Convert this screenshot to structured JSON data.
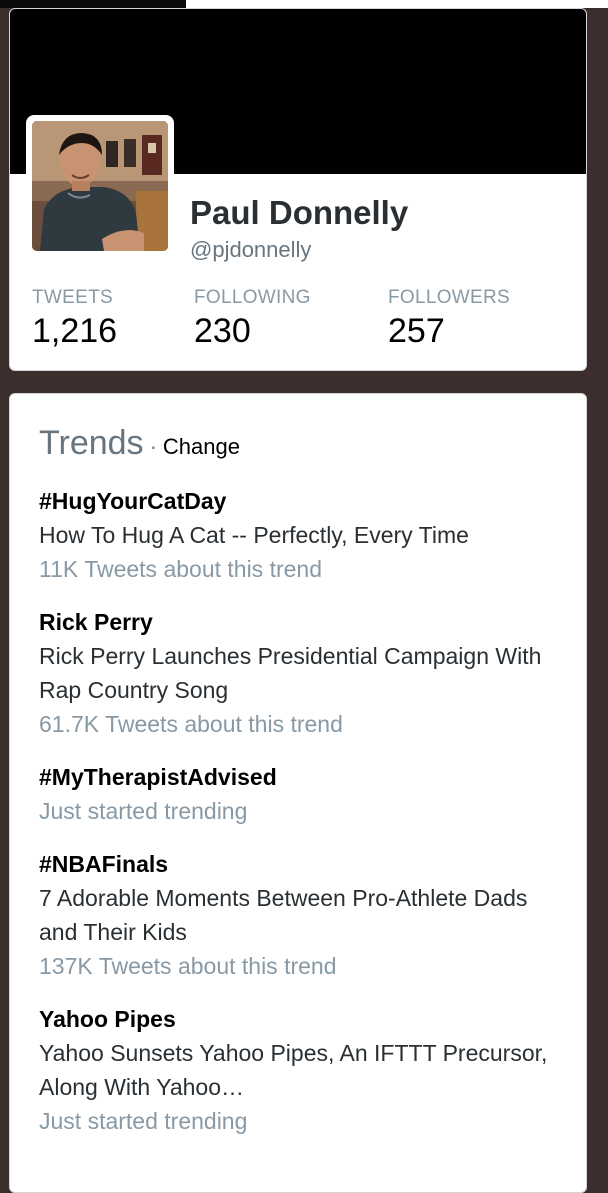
{
  "profile": {
    "name": "Paul Donnelly",
    "handle": "@pjdonnelly",
    "stats": [
      {
        "label": "TWEETS",
        "value": "1,216"
      },
      {
        "label": "FOLLOWING",
        "value": "230"
      },
      {
        "label": "FOLLOWERS",
        "value": "257"
      }
    ]
  },
  "trends": {
    "title": "Trends",
    "separator": "·",
    "change_label": "Change",
    "items": [
      {
        "name": "#HugYourCatDay",
        "description": "How To Hug A Cat -- Perfectly, Every Time",
        "meta": "11K Tweets about this trend"
      },
      {
        "name": "Rick Perry",
        "description": "Rick Perry Launches Presidential Campaign With Rap Country Song",
        "meta": "61.7K Tweets about this trend"
      },
      {
        "name": "#MyTherapistAdvised",
        "description": "",
        "meta": "Just started trending"
      },
      {
        "name": "#NBAFinals",
        "description": "7 Adorable Moments Between Pro-Athlete Dads and Their Kids",
        "meta": "137K Tweets about this trend"
      },
      {
        "name": "Yahoo Pipes",
        "description": "Yahoo Sunsets Yahoo Pipes, An IFTTT Precursor, Along With Yahoo…",
        "meta": "Just started trending"
      }
    ]
  },
  "colors": {
    "page_background": "#3b2e2c",
    "banner": "#000000",
    "muted_text": "#8899a6",
    "secondary_text": "#66757f"
  }
}
